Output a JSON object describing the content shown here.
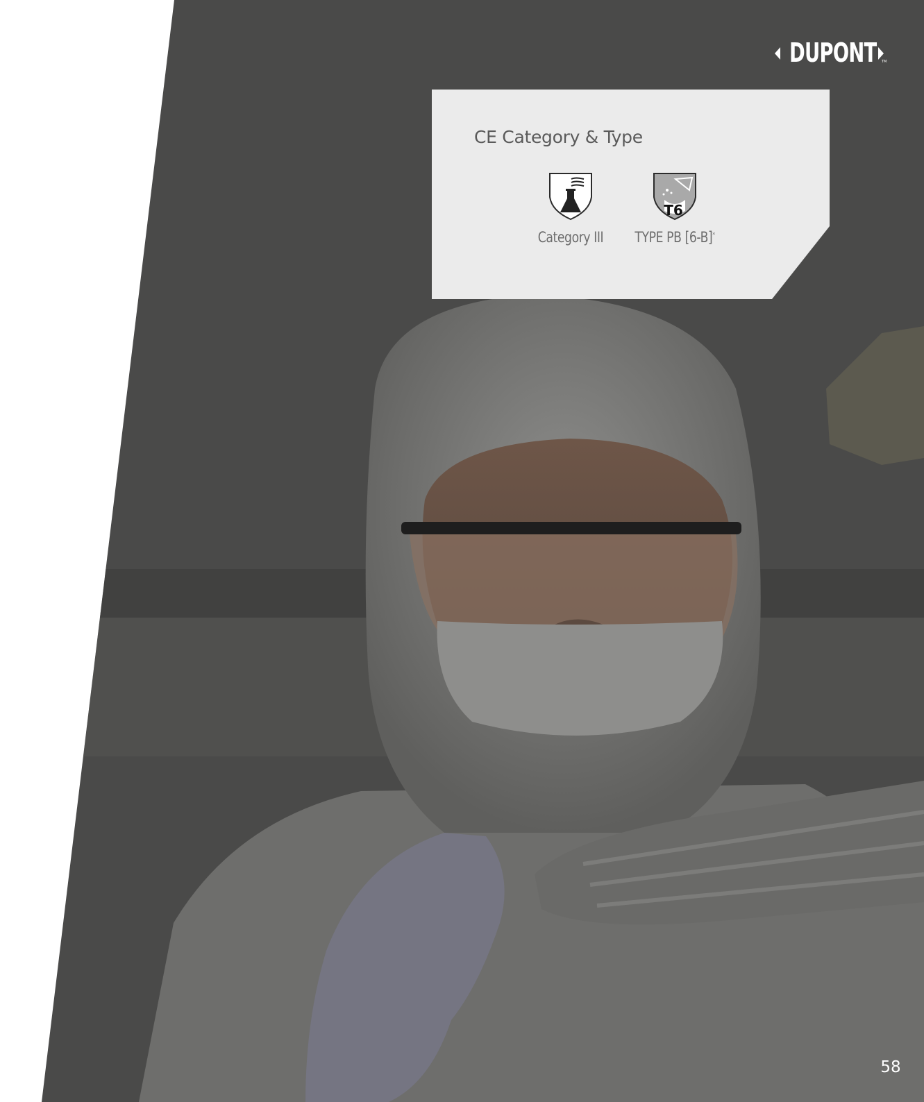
{
  "brand": {
    "logo_text": "DUPONT",
    "trademark": "TM"
  },
  "card": {
    "title": "CE Category & Type",
    "badges": [
      {
        "icon": "chemical-flask-shield-icon",
        "label": "Category III",
        "footnote_mark": ""
      },
      {
        "icon": "type-6-splash-shield-icon",
        "label": "TYPE PB [6-B]",
        "footnote_mark": "*",
        "icon_text": "T6"
      }
    ]
  },
  "background": {
    "image": "worker in white protective coverall, safety goggles and face mask holding a sheet of material"
  },
  "page": {
    "number": "58"
  },
  "colors": {
    "panel": "#4a4a49",
    "card": "#ebebeb",
    "title_text": "#5a5a5a",
    "label_text": "#6d6d6d"
  }
}
